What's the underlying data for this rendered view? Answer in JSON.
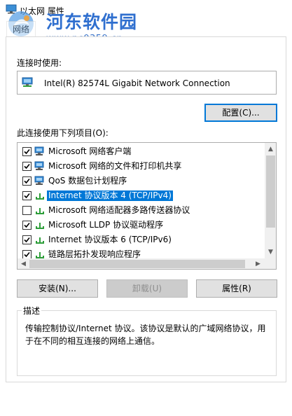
{
  "window": {
    "title": "以太网 属性"
  },
  "watermark": {
    "site_name": "河东软件园",
    "url": "www.pc0359.cn"
  },
  "tabs": [
    {
      "label": "网络"
    }
  ],
  "connect_using": {
    "label": "连接时使用:",
    "adapter": "Intel(R) 82574L Gigabit Network Connection",
    "configure_label": "配置(C)..."
  },
  "items_section": {
    "label": "此连接使用下列项目(O):",
    "items": [
      {
        "checked": true,
        "icon": "network-client-icon",
        "label": "Microsoft 网络客户端"
      },
      {
        "checked": true,
        "icon": "network-client-icon",
        "label": "Microsoft 网络的文件和打印机共享"
      },
      {
        "checked": true,
        "icon": "network-client-icon",
        "label": "QoS 数据包计划程序"
      },
      {
        "checked": true,
        "icon": "protocol-icon",
        "label": "Internet 协议版本 4 (TCP/IPv4)",
        "selected": true
      },
      {
        "checked": false,
        "icon": "protocol-icon",
        "label": "Microsoft 网络适配器多路传送器协议"
      },
      {
        "checked": true,
        "icon": "protocol-icon",
        "label": "Microsoft LLDP 协议驱动程序"
      },
      {
        "checked": true,
        "icon": "protocol-icon",
        "label": "Internet 协议版本 6 (TCP/IPv6)"
      },
      {
        "checked": true,
        "icon": "protocol-icon",
        "label": "链路层拓扑发现响应程序"
      }
    ]
  },
  "actions": {
    "install": "安装(N)...",
    "uninstall": "卸载(U)",
    "properties": "属性(R)"
  },
  "description": {
    "title": "描述",
    "text": "传输控制协议/Internet 协议。该协议是默认的广域网络协议，用于在不同的相互连接的网络上通信。"
  },
  "colors": {
    "accent": "#0078d7",
    "watermark_blue": "#2f6fcf",
    "protocol_green": "#2e9e3a"
  }
}
